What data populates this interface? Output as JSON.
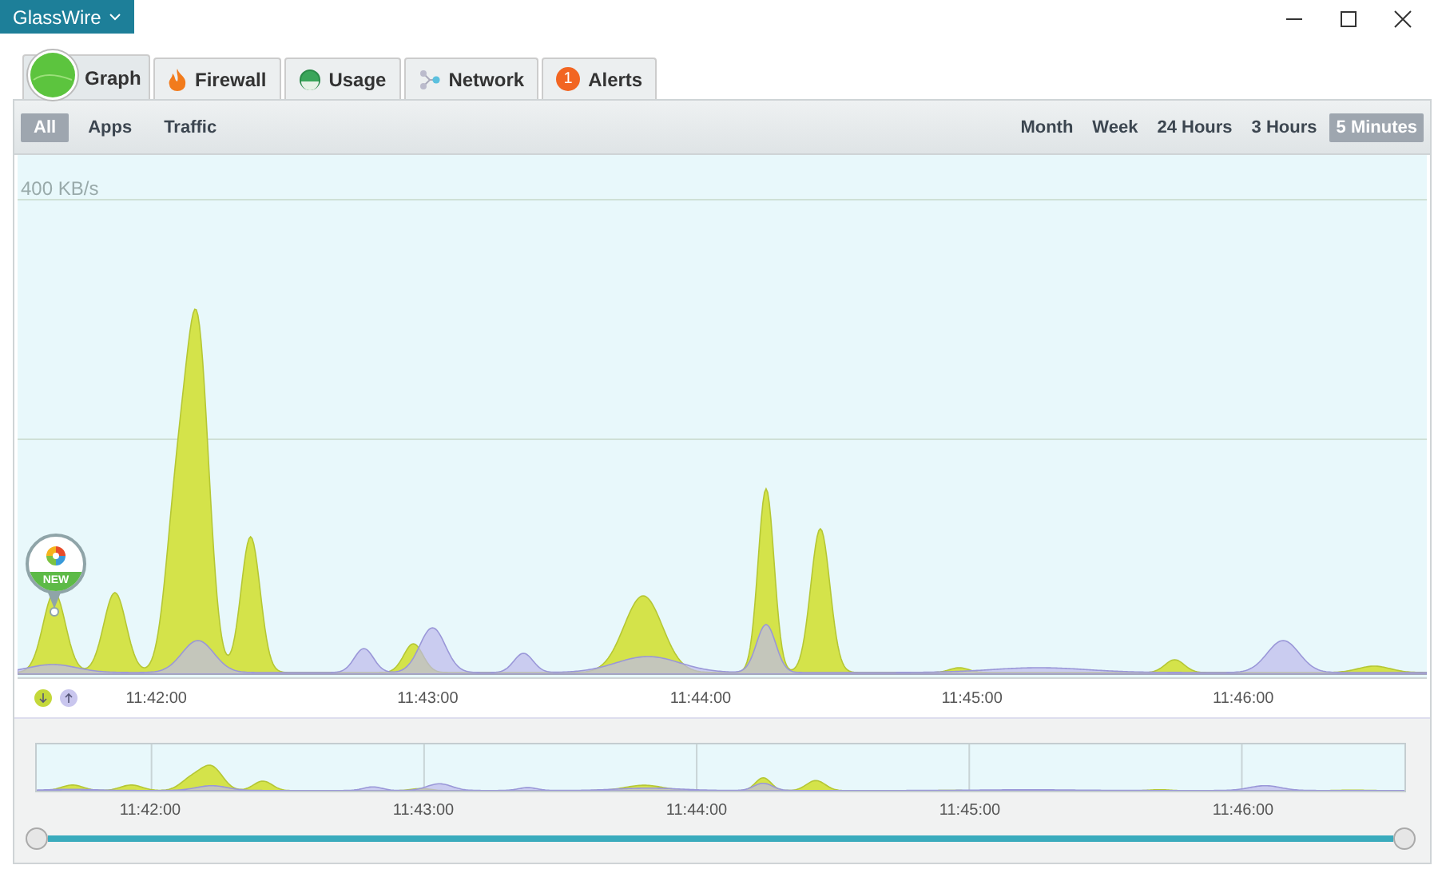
{
  "app_button": {
    "label": "GlassWire"
  },
  "tabs": [
    {
      "kind": "graph",
      "label": "Graph",
      "selected": true
    },
    {
      "kind": "firewall",
      "label": "Firewall",
      "selected": false
    },
    {
      "kind": "usage",
      "label": "Usage",
      "selected": false
    },
    {
      "kind": "network",
      "label": "Network",
      "selected": false
    },
    {
      "kind": "alerts",
      "label": "Alerts",
      "badge": "1",
      "selected": false
    }
  ],
  "filters": [
    {
      "label": "All",
      "selected": true
    },
    {
      "label": "Apps",
      "selected": false
    },
    {
      "label": "Traffic",
      "selected": false
    }
  ],
  "ranges": [
    {
      "label": "Month",
      "selected": false
    },
    {
      "label": "Week",
      "selected": false
    },
    {
      "label": "24 Hours",
      "selected": false
    },
    {
      "label": "3 Hours",
      "selected": false
    },
    {
      "label": "5 Minutes",
      "selected": true
    }
  ],
  "graph": {
    "scale_label": "400 KB/s",
    "marker_badge": "NEW",
    "time_labels": [
      "11:42:00",
      "11:43:00",
      "11:44:00",
      "11:45:00",
      "11:46:00"
    ]
  },
  "overview": {
    "time_labels": [
      "11:42:00",
      "11:43:00",
      "11:44:00",
      "11:45:00",
      "11:46:00"
    ]
  }
}
